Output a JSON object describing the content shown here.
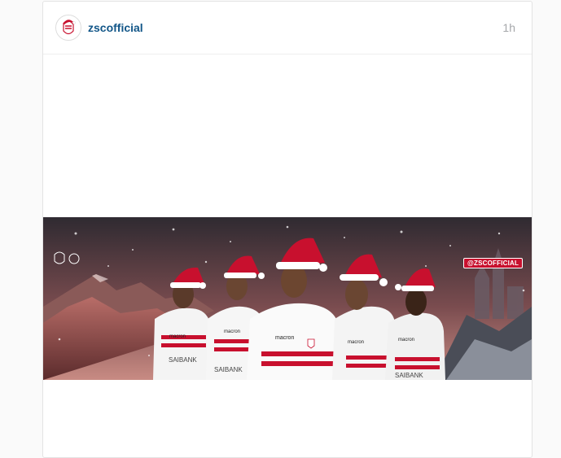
{
  "post": {
    "username": "zscofficial",
    "timestamp": "1h",
    "image_overlay_handle": "@ZSCOFFICIAL",
    "sponsor_text": "macron",
    "shirt_sponsor": "SAIBANK",
    "icons": {
      "avatar": "club-crest-icon",
      "image_logo": "club-crest-icon"
    }
  },
  "colors": {
    "username": "#125688",
    "timestamp": "#a5a7aa",
    "jersey_red": "#c8102e",
    "background": "#fafafa"
  }
}
